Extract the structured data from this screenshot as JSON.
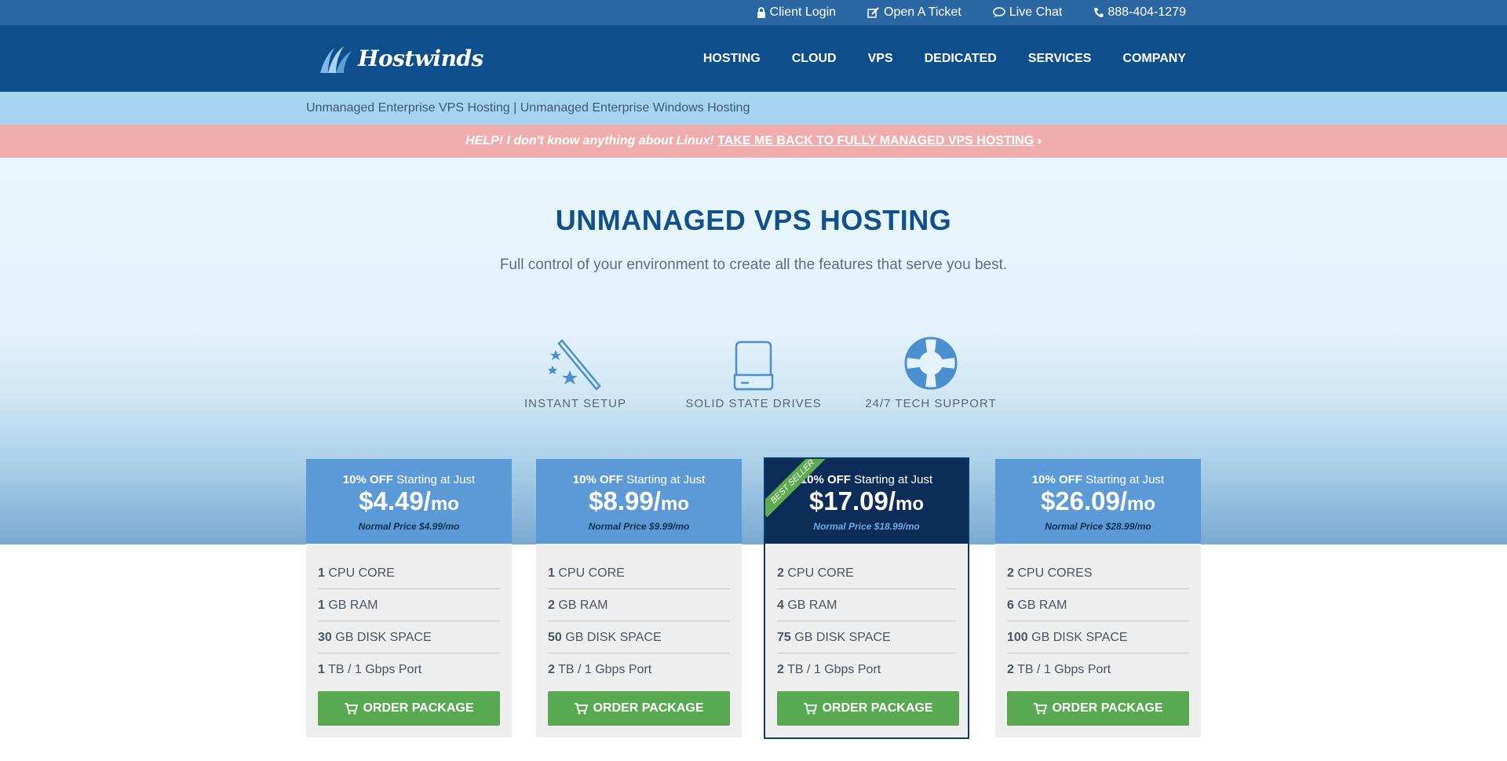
{
  "topbar": {
    "client_login": "Client Login",
    "open_ticket": "Open A Ticket",
    "live_chat": "Live Chat",
    "phone": "888-404-1279"
  },
  "brand": {
    "logo_text": "Hostwinds"
  },
  "nav": {
    "items": [
      "HOSTING",
      "CLOUD",
      "VPS",
      "DEDICATED",
      "SERVICES",
      "COMPANY"
    ]
  },
  "subnav": {
    "link1": "Unmanaged Enterprise VPS Hosting",
    "separator": " | ",
    "link2": "Unmanaged Enterprise Windows Hosting"
  },
  "alert": {
    "question": "HELP! I don't know anything about Linux!",
    "link": "TAKE ME BACK TO FULLY MANAGED VPS HOSTING",
    "chevron": "›"
  },
  "hero": {
    "title": "UNMANAGED VPS HOSTING",
    "subtitle": "Full control of your environment to create all the features that serve you best.",
    "features": [
      {
        "icon": "magic-wand-icon",
        "label": "INSTANT SETUP"
      },
      {
        "icon": "hard-drive-icon",
        "label": "SOLID STATE DRIVES"
      },
      {
        "icon": "life-ring-icon",
        "label": "24/7 TECH SUPPORT"
      }
    ]
  },
  "plans": [
    {
      "discount": "10% OFF",
      "starting": "Starting at Just",
      "price": "$4.49/",
      "per": "mo",
      "normal": "Normal Price $4.99/mo",
      "specs": [
        {
          "value": "1",
          "label": "CPU CORE"
        },
        {
          "value": "1",
          "label": "GB RAM"
        },
        {
          "value": "30",
          "label": "GB DISK SPACE"
        },
        {
          "value": "1",
          "label": "TB / 1 Gbps Port"
        }
      ],
      "button": "ORDER PACKAGE"
    },
    {
      "discount": "10% OFF",
      "starting": "Starting at Just",
      "price": "$8.99/",
      "per": "mo",
      "normal": "Normal Price $9.99/mo",
      "specs": [
        {
          "value": "1",
          "label": "CPU CORE"
        },
        {
          "value": "2",
          "label": "GB RAM"
        },
        {
          "value": "50",
          "label": "GB DISK SPACE"
        },
        {
          "value": "2",
          "label": "TB / 1 Gbps Port"
        }
      ],
      "button": "ORDER PACKAGE"
    },
    {
      "badge": "BEST SELLER",
      "discount": "10% OFF",
      "starting": "Starting at Just",
      "price": "$17.09/",
      "per": "mo",
      "normal": "Normal Price $18.99/mo",
      "specs": [
        {
          "value": "2",
          "label": "CPU CORE"
        },
        {
          "value": "4",
          "label": "GB RAM"
        },
        {
          "value": "75",
          "label": "GB DISK SPACE"
        },
        {
          "value": "2",
          "label": "TB / 1 Gbps Port"
        }
      ],
      "button": "ORDER PACKAGE"
    },
    {
      "discount": "10% OFF",
      "starting": "Starting at Just",
      "price": "$26.09/",
      "per": "mo",
      "normal": "Normal Price $28.99/mo",
      "specs": [
        {
          "value": "2",
          "label": "CPU CORES"
        },
        {
          "value": "6",
          "label": "GB RAM"
        },
        {
          "value": "100",
          "label": "GB DISK SPACE"
        },
        {
          "value": "2",
          "label": "TB / 1 Gbps Port"
        }
      ],
      "button": "ORDER PACKAGE"
    }
  ],
  "colors": {
    "topbar": "#2b67a2",
    "navbar": "#0e4e8c",
    "subnav": "#a6d3f0",
    "alert": "#efadae",
    "card_header": "#5b9ad6",
    "featured_header": "#0c2d57",
    "order_button": "#59a852"
  }
}
